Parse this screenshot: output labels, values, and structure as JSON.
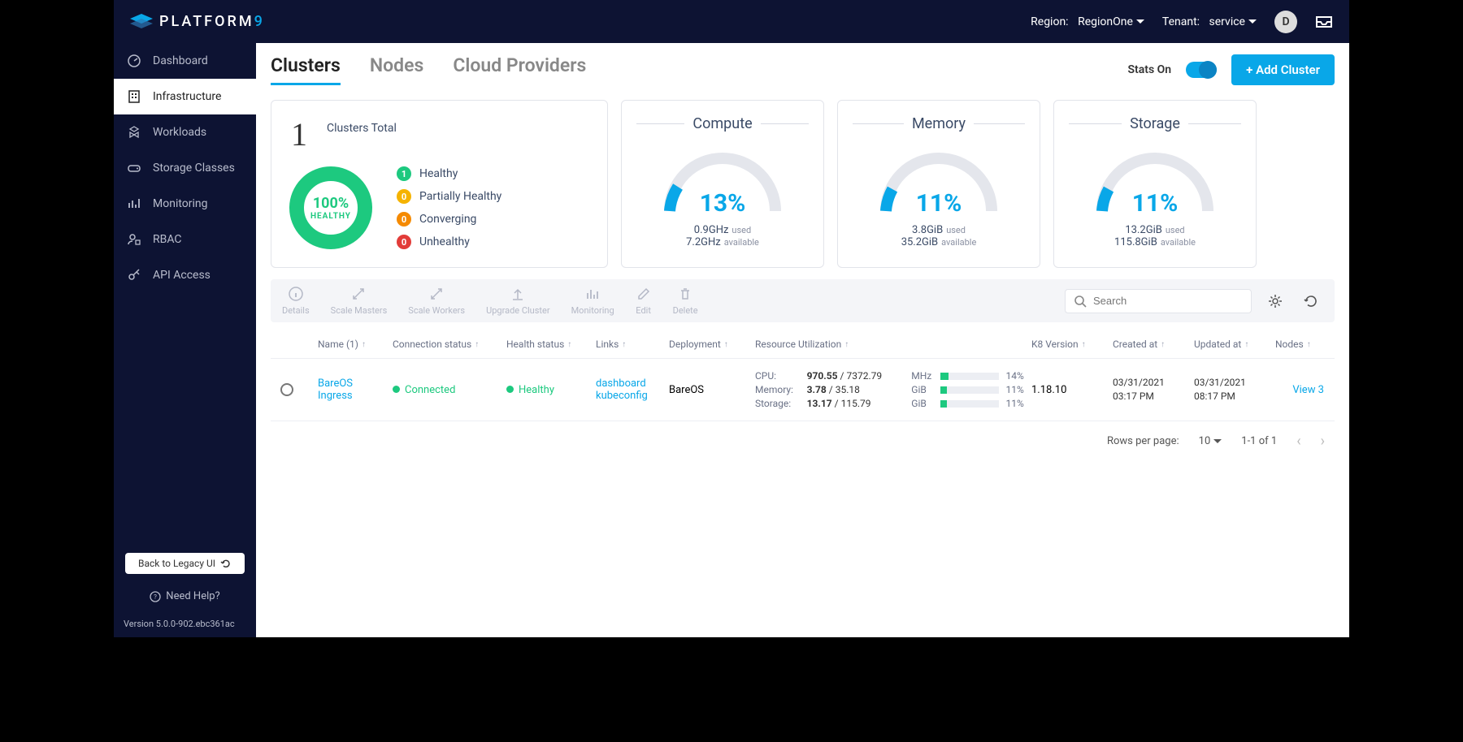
{
  "topbar": {
    "brand_prefix": "PLATFORM",
    "brand_suffix": "9",
    "region_label": "Region:",
    "region_value": "RegionOne",
    "tenant_label": "Tenant:",
    "tenant_value": "service",
    "avatar_initial": "D"
  },
  "sidebar": {
    "items": [
      {
        "label": "Dashboard"
      },
      {
        "label": "Infrastructure"
      },
      {
        "label": "Workloads"
      },
      {
        "label": "Storage Classes"
      },
      {
        "label": "Monitoring"
      },
      {
        "label": "RBAC"
      },
      {
        "label": "API Access"
      }
    ],
    "legacy_btn": "Back to Legacy UI",
    "help": "Need Help?",
    "version": "Version 5.0.0-902.ebc361ac"
  },
  "tabs": {
    "items": [
      "Clusters",
      "Nodes",
      "Cloud Providers"
    ],
    "stats_label": "Stats On",
    "add_label": "+ Add Cluster"
  },
  "summary": {
    "count": "1",
    "count_label": "Clusters Total",
    "donut_pct": "100%",
    "donut_lbl": "HEALTHY",
    "legend": [
      {
        "n": "1",
        "label": "Healthy",
        "cls": "green"
      },
      {
        "n": "0",
        "label": "Partially Healthy",
        "cls": "yellow"
      },
      {
        "n": "0",
        "label": "Converging",
        "cls": "orange"
      },
      {
        "n": "0",
        "label": "Unhealthy",
        "cls": "red"
      }
    ]
  },
  "metrics": {
    "compute": {
      "title": "Compute",
      "pct": "13%",
      "used": "0.9GHz",
      "avail": "7.2GHz"
    },
    "memory": {
      "title": "Memory",
      "pct": "11%",
      "used": "3.8GiB",
      "avail": "35.2GiB"
    },
    "storage": {
      "title": "Storage",
      "pct": "11%",
      "used": "13.2GiB",
      "avail": "115.8GiB"
    },
    "used_lbl": "used",
    "avail_lbl": "available"
  },
  "toolbar": {
    "actions": [
      "Details",
      "Scale Masters",
      "Scale Workers",
      "Upgrade Cluster",
      "Monitoring",
      "Edit",
      "Delete"
    ],
    "search_placeholder": "Search"
  },
  "table": {
    "headers": {
      "name": "Name (1)",
      "conn": "Connection status",
      "health": "Health status",
      "links": "Links",
      "deploy": "Deployment",
      "util": "Resource Utilization",
      "k8": "K8 Version",
      "created": "Created at",
      "updated": "Updated at",
      "nodes": "Nodes"
    },
    "row": {
      "name1": "BareOS",
      "name2": "Ingress",
      "conn": "Connected",
      "health": "Healthy",
      "link1": "dashboard",
      "link2": "kubeconfig",
      "deploy": "BareOS",
      "util": {
        "cpu": {
          "label": "CPU:",
          "used": "970.55",
          "total": "7372.79",
          "unit": "MHz",
          "pct": "14%",
          "fill": 14
        },
        "memory": {
          "label": "Memory:",
          "used": "3.78",
          "total": "35.18",
          "unit": "GiB",
          "pct": "11%",
          "fill": 11
        },
        "storage": {
          "label": "Storage:",
          "used": "13.17",
          "total": "115.79",
          "unit": "GiB",
          "pct": "11%",
          "fill": 11
        }
      },
      "k8": "1.18.10",
      "created1": "03/31/2021",
      "created2": "03:17 PM",
      "updated1": "03/31/2021",
      "updated2": "08:17 PM",
      "nodes": "View 3"
    }
  },
  "pager": {
    "rpp_label": "Rows per page:",
    "rpp_value": "10",
    "range": "1-1 of 1"
  }
}
